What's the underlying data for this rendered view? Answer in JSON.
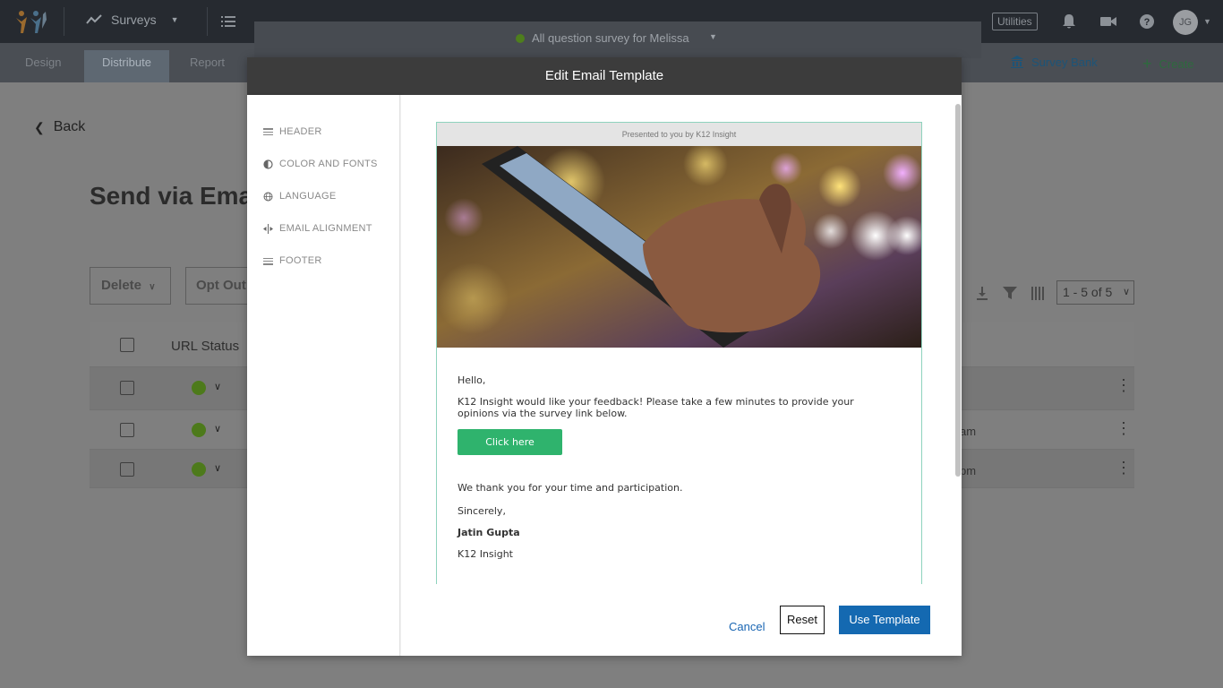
{
  "topbar": {
    "nav_label": "Surveys",
    "utilities_label": "Utilities",
    "avatar_initials": "JG"
  },
  "subnav": {
    "tabs": [
      {
        "label": "Design"
      },
      {
        "label": "Distribute"
      },
      {
        "label": "Report"
      }
    ],
    "active_tab": "Distribute",
    "survey_bank": "Survey Bank",
    "create": "Create"
  },
  "survey_selector": {
    "name": "All question survey for Melissa",
    "status_color": "#7cc23b"
  },
  "page": {
    "back_label": "Back",
    "title": "Send via Ema",
    "buttons": {
      "delete": "Delete",
      "opt_out": "Opt Out"
    },
    "table": {
      "header_url_status": "URL Status",
      "rows": [
        {
          "time": ""
        },
        {
          "time": "am"
        },
        {
          "time": "pm"
        }
      ]
    },
    "pager": "1 - 5 of 5"
  },
  "modal": {
    "title": "Edit Email Template",
    "sidebar": [
      {
        "label": "HEADER",
        "icon": "header-icon"
      },
      {
        "label": "COLOR AND FONTS",
        "icon": "contrast-icon"
      },
      {
        "label": "LANGUAGE",
        "icon": "globe-icon"
      },
      {
        "label": "EMAIL ALIGNMENT",
        "icon": "alignment-icon"
      },
      {
        "label": "FOOTER",
        "icon": "footer-icon"
      }
    ],
    "email": {
      "presented_by": "Presented to you by K12 Insight",
      "greeting": "Hello,",
      "body_line1": "K12 Insight would like your feedback! Please take a few minutes to provide your",
      "body_line2": "opinions via the survey link below.",
      "cta_label": "Click here",
      "thanks": "We thank you for your time and participation.",
      "signoff": "Sincerely,",
      "sender_name": "Jatin Gupta",
      "sender_org": "K12 Insight"
    },
    "footer_buttons": {
      "cancel": "Cancel",
      "reset": "Reset",
      "use_template": "Use Template"
    }
  },
  "colors": {
    "accent_blue": "#1469b1",
    "cta_green": "#2fb36d",
    "frame_border": "#8ed3bd"
  }
}
